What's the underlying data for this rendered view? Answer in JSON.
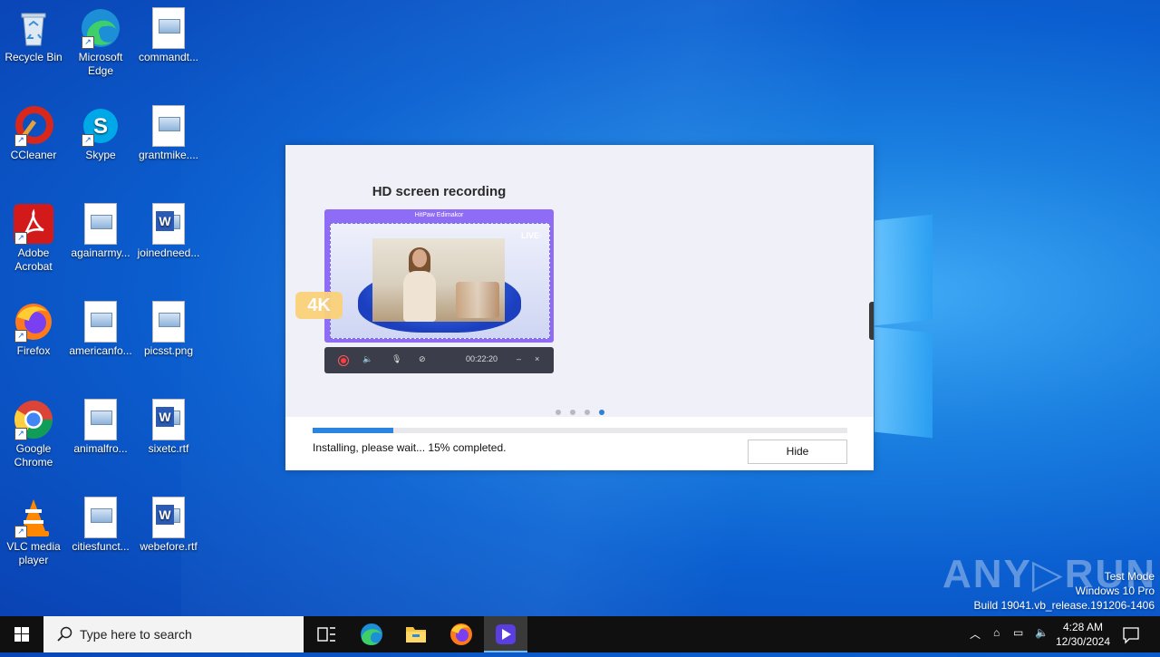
{
  "desktop": {
    "icons": [
      {
        "label": "Recycle Bin",
        "icon": "recycle-bin-icon"
      },
      {
        "label": "Microsoft Edge",
        "icon": "edge-icon"
      },
      {
        "label": "commandt...",
        "icon": "image-file-icon"
      },
      {
        "label": "CCleaner",
        "icon": "ccleaner-icon"
      },
      {
        "label": "Skype",
        "icon": "skype-icon"
      },
      {
        "label": "grantmike....",
        "icon": "image-file-icon"
      },
      {
        "label": "Adobe Acrobat",
        "icon": "acrobat-icon"
      },
      {
        "label": "againarmy...",
        "icon": "image-file-icon"
      },
      {
        "label": "joinedneed...",
        "icon": "word-file-icon"
      },
      {
        "label": "Firefox",
        "icon": "firefox-icon"
      },
      {
        "label": "americanfo...",
        "icon": "image-file-icon"
      },
      {
        "label": "picsst.png",
        "icon": "image-file-icon"
      },
      {
        "label": "Google Chrome",
        "icon": "chrome-icon"
      },
      {
        "label": "animalfro...",
        "icon": "image-file-icon"
      },
      {
        "label": "sixetc.rtf",
        "icon": "word-file-icon"
      },
      {
        "label": "VLC media player",
        "icon": "vlc-icon"
      },
      {
        "label": "citiesfunct...",
        "icon": "image-file-icon"
      },
      {
        "label": "webefore.rtf",
        "icon": "word-file-icon"
      }
    ]
  },
  "installer": {
    "slide_title": "HD screen recording",
    "preview_app_name": "HitPaw Edimakor",
    "preview_live": "LIVE·",
    "badge": "4K",
    "timer": "00:22:20",
    "minimize_glyph": "–",
    "close_glyph": "×",
    "slide_count": 4,
    "active_slide": 4,
    "progress_fraction": 0.15,
    "status_text": "Installing, please wait... 15% completed.",
    "hide_label": "Hide"
  },
  "watermark": {
    "brand": "ANY RUN",
    "mode": "Test Mode",
    "edition": "Windows 10 Pro",
    "build": "Build 19041.vb_release.191206-1406"
  },
  "taskbar": {
    "search_placeholder": "Type here to search",
    "time": "4:28 AM",
    "date": "12/30/2024",
    "pinned": [
      "task-view-icon",
      "edge-icon",
      "file-explorer-icon",
      "firefox-icon",
      "hitpaw-icon"
    ],
    "active_app": "hitpaw-icon"
  },
  "colors": {
    "accent": "#2b84e0",
    "preview_purple": "#8f6cf5",
    "badge_yellow": "#fbd27a"
  }
}
